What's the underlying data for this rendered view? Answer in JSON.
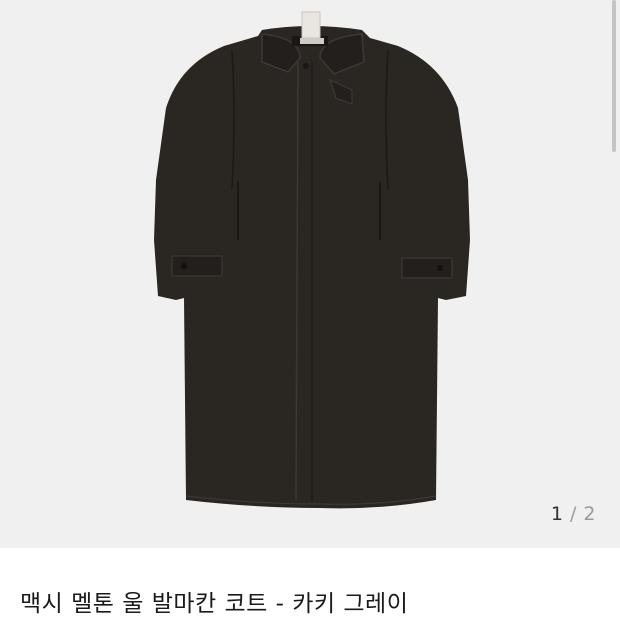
{
  "product": {
    "title": "맥시 멜톤 울 발마칸 코트 - 카키 그레이",
    "image": {
      "subject": "coat",
      "color": "#2a2622"
    }
  },
  "gallery": {
    "current": "1",
    "separator": "/",
    "total": "2",
    "background": "#f0f0f0"
  }
}
